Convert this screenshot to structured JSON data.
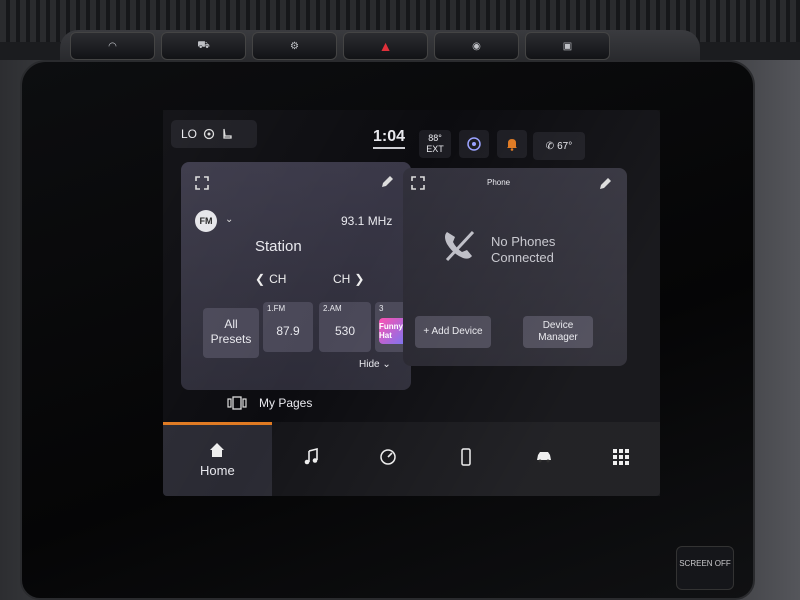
{
  "status": {
    "climate_left": "LO",
    "time": "1:04",
    "outside_temp": "88°",
    "outside_label": "EXT",
    "climate_right": "67°"
  },
  "radio": {
    "band": "FM",
    "frequency": "93.1 MHz",
    "station": "Station",
    "ch_prev": "CH",
    "ch_next": "CH",
    "all_presets": "All Presets",
    "presets": [
      {
        "num": "1.FM",
        "value": "87.9"
      },
      {
        "num": "2.AM",
        "value": "530"
      },
      {
        "num": "3",
        "value": "Funny Hat"
      }
    ],
    "hide": "Hide"
  },
  "phone": {
    "title": "Phone",
    "status": "No Phones Connected",
    "add_device": "+ Add Device",
    "device_manager": "Device Manager"
  },
  "my_pages": "My Pages",
  "nav": {
    "home": "Home"
  },
  "hardware": {
    "screen_off": "SCREEN OFF"
  },
  "colors": {
    "accent": "#e07a22",
    "card": "#3a3848",
    "hazard": "#e0303a"
  }
}
